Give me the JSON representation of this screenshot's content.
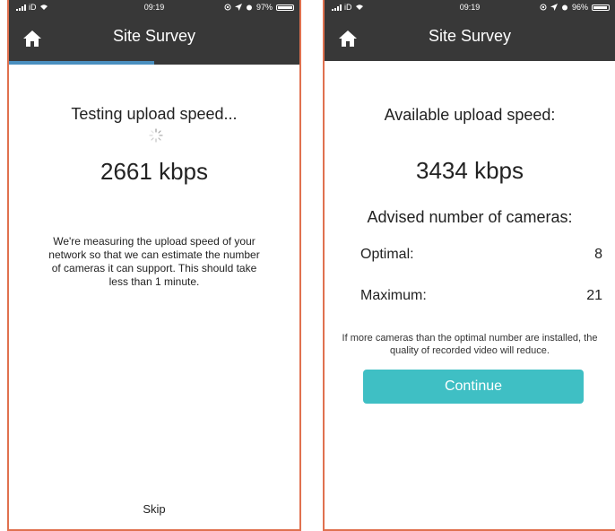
{
  "colors": {
    "status_bar": "#383838",
    "nav_bar": "#383838",
    "accent_progress": "#4a8fbf",
    "button": "#3fbfc4",
    "border": "#e0714f"
  },
  "left_screen": {
    "status": {
      "carrier": "iD",
      "time": "09:19",
      "battery": "97%",
      "battery_level": 0.97
    },
    "nav": {
      "title": "Site Survey",
      "home_icon": "home-icon"
    },
    "progress": 0.5,
    "heading": "Testing upload speed...",
    "speed": "2661 kbps",
    "description": "We're measuring the upload speed of your network so that we can estimate the number of cameras it can support. This should take less than 1 minute.",
    "skip_label": "Skip"
  },
  "right_screen": {
    "status": {
      "carrier": "iD",
      "time": "09:19",
      "battery": "96%",
      "battery_level": 0.96
    },
    "nav": {
      "title": "Site Survey",
      "home_icon": "home-icon"
    },
    "heading": "Available upload speed:",
    "speed": "3434 kbps",
    "subheading": "Advised number of cameras:",
    "optimal_label": "Optimal:",
    "optimal_value": "8",
    "maximum_label": "Maximum:",
    "maximum_value": "21",
    "note": "If more cameras than the optimal number are installed, the quality of recorded video will reduce.",
    "continue_label": "Continue"
  }
}
